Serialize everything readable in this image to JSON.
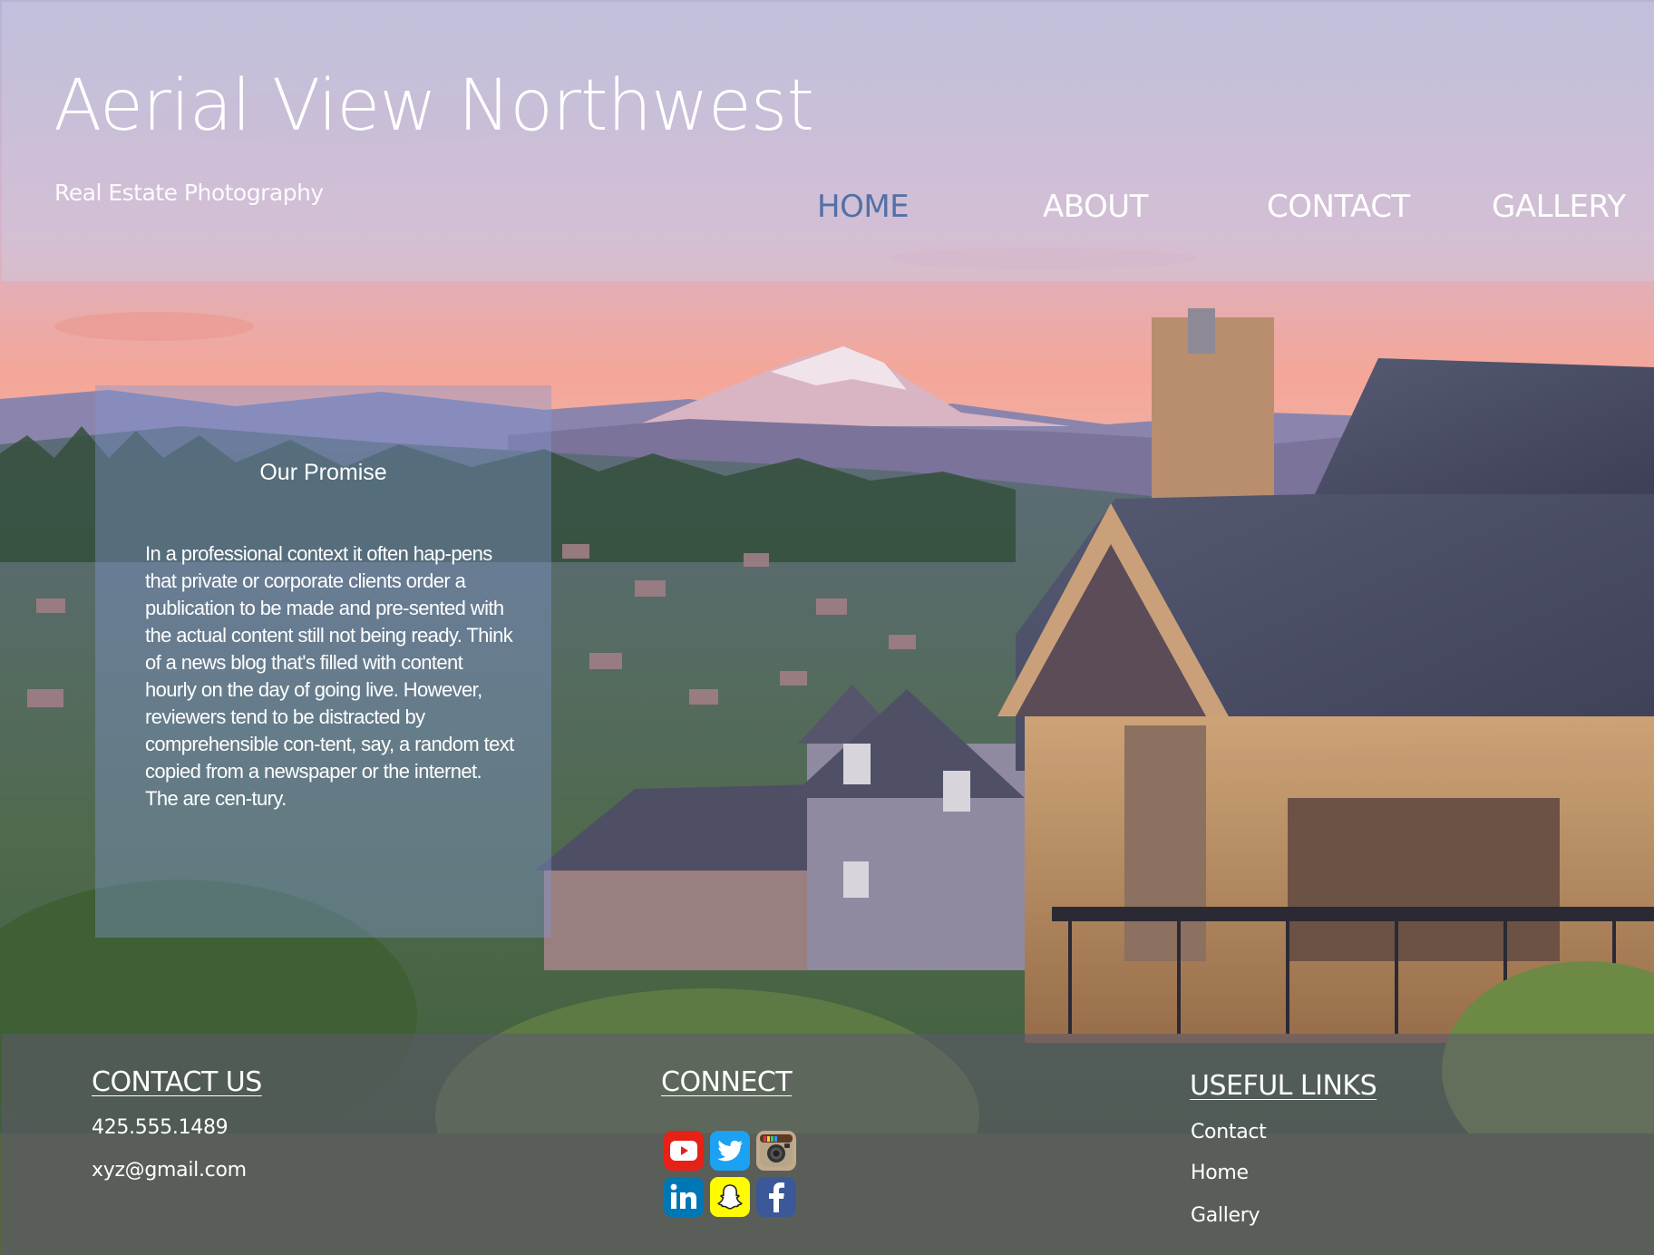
{
  "site": {
    "title": "Aerial View Northwest",
    "subtitle": "Real Estate Photography"
  },
  "nav": {
    "items": [
      {
        "label": "HOME",
        "active": true
      },
      {
        "label": "ABOUT",
        "active": false
      },
      {
        "label": "CONTACT",
        "active": false
      },
      {
        "label": "GALLERY",
        "active": false
      }
    ]
  },
  "promise": {
    "title": "Our Promise",
    "body": "In a professional context it often hap-pens that private or corporate clients order a publication to be made and pre-sented with the actual content still not being ready. Think of a news blog that's filled with content hourly on the day of going live. However, reviewers tend to be distracted by comprehensible con-tent, say, a random text copied from a newspaper or the internet. The are cen-tury."
  },
  "footer": {
    "contact": {
      "heading": "CONTACT US",
      "phone": "425.555.1489",
      "email": "xyz@gmail.com"
    },
    "connect": {
      "heading": "CONNECT",
      "icons": [
        "youtube-icon",
        "twitter-icon",
        "instagram-icon",
        "linkedin-icon",
        "snapchat-icon",
        "facebook-icon"
      ]
    },
    "links": {
      "heading": "USEFUL LINKS",
      "items": [
        "Contact",
        "Home",
        "Gallery"
      ]
    }
  },
  "colors": {
    "nav_active": "#5270a6",
    "header_overlay": "#cdd0e8",
    "card_overlay": "#8296d2",
    "footer_overlay": "#5c5a6c"
  }
}
